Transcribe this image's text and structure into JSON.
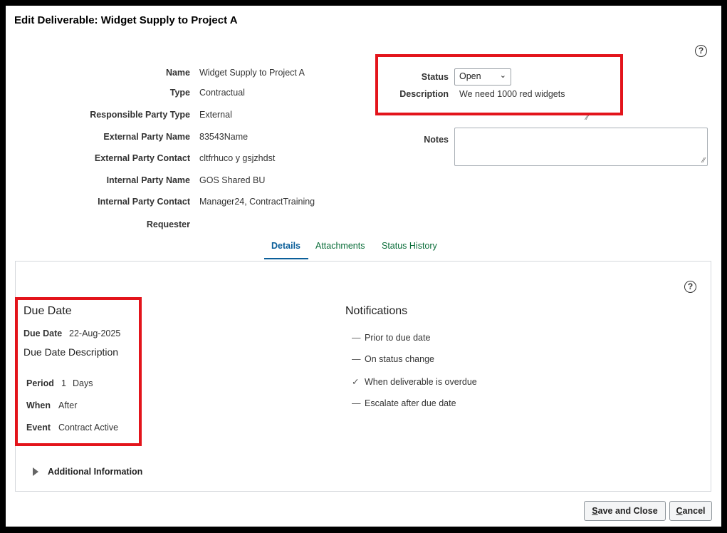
{
  "dialog": {
    "title": "Edit Deliverable: Widget Supply to Project A"
  },
  "help_icon": "?",
  "header_fields": {
    "name": {
      "label": "Name",
      "value": "Widget Supply to Project A"
    },
    "type": {
      "label": "Type",
      "value": "Contractual"
    },
    "responsible_party_type": {
      "label": "Responsible Party Type",
      "value": "External"
    },
    "external_party_name": {
      "label": "External Party Name",
      "value": "83543Name"
    },
    "external_party_contact": {
      "label": "External Party Contact",
      "value": "cltfrhuco y gsjzhdst"
    },
    "internal_party_name": {
      "label": "Internal Party Name",
      "value": "GOS Shared BU"
    },
    "internal_party_contact": {
      "label": "Internal Party Contact",
      "value": "Manager24, ContractTraining"
    },
    "requester": {
      "label": "Requester",
      "value": ""
    }
  },
  "status": {
    "label": "Status",
    "value": "Open",
    "chevron": "⌄"
  },
  "description": {
    "label": "Description",
    "value": "We need 1000 red widgets"
  },
  "notes": {
    "label": "Notes",
    "value": ""
  },
  "tabs": [
    {
      "label": "Details",
      "active": true
    },
    {
      "label": "Attachments",
      "active": false
    },
    {
      "label": "Status History",
      "active": false
    }
  ],
  "due_date_section": {
    "heading": "Due Date",
    "due_date": {
      "label": "Due Date",
      "value": "22-Aug-2025"
    },
    "description_heading": "Due Date Description",
    "period": {
      "label": "Period",
      "number": "1",
      "unit": "Days"
    },
    "when": {
      "label": "When",
      "value": "After"
    },
    "event": {
      "label": "Event",
      "value": "Contract Active"
    }
  },
  "notifications": {
    "heading": "Notifications",
    "items": [
      {
        "label": "Prior to due date",
        "mark": "—",
        "checked": false
      },
      {
        "label": "On status change",
        "mark": "—",
        "checked": false
      },
      {
        "label": "When deliverable is overdue",
        "mark": "✓",
        "checked": true
      },
      {
        "label": "Escalate after due date",
        "mark": "—",
        "checked": false
      }
    ]
  },
  "additional_information": {
    "label": "Additional Information"
  },
  "buttons": {
    "save_and_close": {
      "mnemonic": "S",
      "rest": "ave and Close"
    },
    "cancel": {
      "mnemonic": "C",
      "rest": "ancel"
    }
  },
  "colors": {
    "highlight": "#e3141b",
    "active_tab": "#0b5f9a",
    "tab": "#0b6e3a"
  }
}
